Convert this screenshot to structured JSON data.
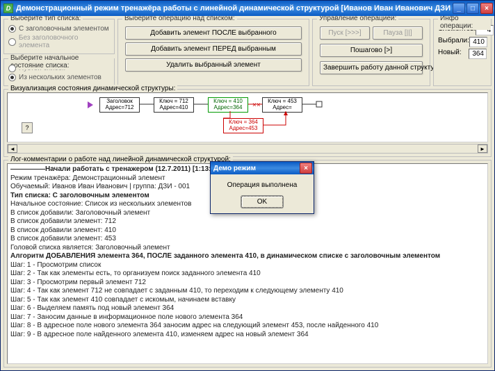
{
  "window": {
    "title": "Демонстрационный режим тренажёра работы с линейной динамической структурой [Иванов Иван Иванович ДЗИ - 001]",
    "icon_label": "D"
  },
  "groups": {
    "list_type": {
      "legend": "Выберите тип списка:",
      "opt1": "С заголовочным элементом",
      "opt2": "Без заголовочного элемента"
    },
    "init_state": {
      "legend": "Выберите начальное состояние списка:",
      "opt1": "Пустой список",
      "opt2": "Из нескольких элементов"
    },
    "operations": {
      "legend": "Выберите операцию над списком:",
      "btn_add_after": "Добавить элемент ПОСЛЕ выбранного",
      "btn_add_before": "Добавить элемент ПЕРЕД выбранным",
      "btn_delete": "Удалить выбранный элемент"
    },
    "control": {
      "legend": "Управление операцией:",
      "btn_start": "Пуск [>>>]",
      "btn_pause": "Пауза [||]",
      "btn_step": "Пошагово [>]",
      "btn_finish": "Завершить работу данной структуры"
    },
    "stats": {
      "legend": "Инфо операции:",
      "label_elems": "Элементов:",
      "val_elems": "4",
      "label_selected": "Выбрали:",
      "val_selected": "410",
      "label_new": "Новый:",
      "val_new": "364"
    },
    "viz": {
      "legend": "Визуализация состояния динамической структуры:",
      "qmark": "?",
      "nodes": {
        "head": "Заголовок\nАдрес=712",
        "n1": "Ключ = 712\nАдрес=410",
        "n2": "Ключ = 410\nАдрес=364",
        "n3": "Ключ = 453\nАдрес=",
        "new": "Ключ = 364\nАдрес=453"
      }
    },
    "log": {
      "legend": "Лог-комментарии о работе над линейной динамической структурой:"
    }
  },
  "log_lines": [
    "—————Начали работать с тренажером (12.7.2011) [1:13:13]—————",
    "Режим тренажёра: Демонстрационный элемент",
    "Обучаемый: Иванов Иван Иванович | группа: ДЗИ - 001",
    "",
    "Тип списка: С заголовочным элементом",
    "",
    "Начальное состояние: Список из нескольких элементов",
    "В список добавили: Заголовочный элемент",
    "В список добавили элемент: 712",
    "В список добавили элемент: 410",
    "В список добавили элемент: 453",
    "Головой списка является: Заголовочный элемент",
    "",
    "Алгоритм ДОБАВЛЕНИЯ элемента 364, ПОСЛЕ заданного элемента 410, в динамическом списке с заголовочным элементом",
    "Шаг: 1 - Просмотрим список",
    "Шаг: 2 - Так как элементы есть, то организуем поиск заданного элемента 410",
    "Шаг: 3 - Просмотрим первый элемент 712",
    "Шаг: 4 - Так как элемент 712 не совпадает с заданным 410, то переходим к следующему элементу 410",
    "Шаг: 5 - Так как элемент 410 совпадает с искомым, начинаем вставку",
    "Шаг: 6 - Выделяем память под новый элемент 364",
    "Шаг: 7 - Заносим данные в информационное поле нового элемента 364",
    "Шаг: 8 - В адресное поле нового элемента 364 заносим адрес на следующий элемент 453, после найденного 410",
    "Шаг: 9 - В адресное поле найденного элемента 410, изменяем адрес на новый элемент 364"
  ],
  "modal": {
    "title": "Демо режим",
    "text": "Операция выполнена",
    "ok": "OK"
  }
}
